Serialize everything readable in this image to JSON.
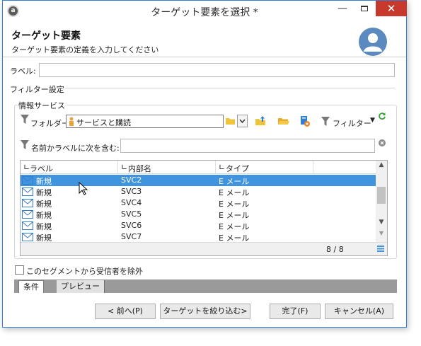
{
  "window": {
    "title": "ターゲット要素を選択 *"
  },
  "header": {
    "title": "ターゲット要素",
    "subtitle": "ターゲット要素の定義を入力してください"
  },
  "label_field": {
    "label": "ラベル:",
    "value": ""
  },
  "filter_section": {
    "title": "フィルター設定"
  },
  "info_service": {
    "group_title": "情報サービス",
    "folder_label": "フォルダー:",
    "folder_value": "サービスと購読",
    "filter_button": "フィルター",
    "search_label": "名前かラベルに次を含む:",
    "search_value": ""
  },
  "list": {
    "columns": [
      "ラベル",
      "内部名",
      "タイプ"
    ],
    "rows": [
      {
        "label": "新規",
        "internal": "SVC2",
        "type": "E メール",
        "selected": true
      },
      {
        "label": "新規",
        "internal": "SVC3",
        "type": "E メール",
        "selected": false
      },
      {
        "label": "新規",
        "internal": "SVC4",
        "type": "E メール",
        "selected": false
      },
      {
        "label": "新規",
        "internal": "SVC5",
        "type": "E メール",
        "selected": false
      },
      {
        "label": "新規",
        "internal": "SVC6",
        "type": "E メール",
        "selected": false
      },
      {
        "label": "新規",
        "internal": "SVC7",
        "type": "E メール",
        "selected": false
      }
    ],
    "count": "8 / 8"
  },
  "exclude_checkbox": {
    "label": "このセグメントから受信者を除外",
    "checked": false
  },
  "tabs": [
    "条件",
    "プレビュー"
  ],
  "buttons": {
    "back": "< 前へ(P)",
    "narrow": "ターゲットを絞り込む>",
    "finish": "完了(F)",
    "cancel": "キャンセル(A)"
  },
  "icons": [
    "app-icon",
    "minimize-icon",
    "maximize-icon",
    "close-icon",
    "avatar-icon",
    "filter-funnel-icon",
    "folder-icon",
    "folder-up-icon",
    "folder-open-icon",
    "folder-settings-icon",
    "refresh-icon",
    "clear-icon",
    "email-icon",
    "sort-icon",
    "menu-icon"
  ],
  "colors": {
    "selection": "#3f94dd",
    "close": "#c7392d",
    "tabs_bar": "#9a9a9a"
  }
}
